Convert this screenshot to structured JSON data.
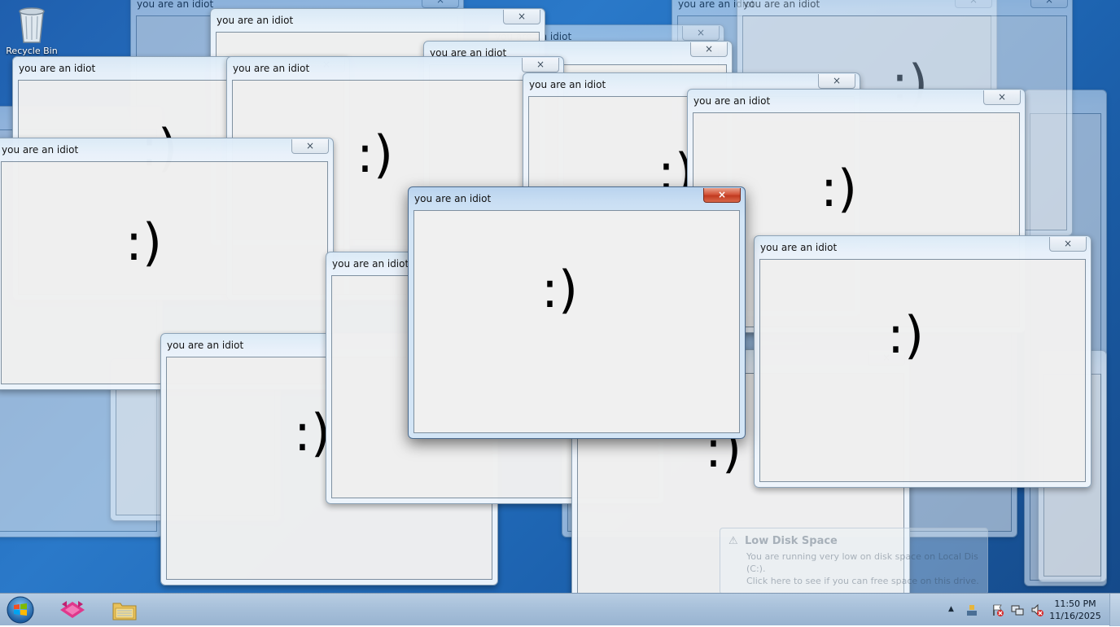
{
  "desktop": {
    "icons": [
      {
        "label": "Recycle Bin",
        "icon": "recycle-bin-icon"
      }
    ]
  },
  "popup": {
    "title": "you are an idiot",
    "content": ":)",
    "close_glyph": "×"
  },
  "notification": {
    "title": "Low Disk Space",
    "line1": "You are running very low on disk space on Local Dis",
    "line2": "(C:).",
    "line3": "Click here to see if you can free space on this drive."
  },
  "taskbar": {
    "pinned": [
      {
        "name": "start-orb",
        "icon": "windows-logo-icon"
      },
      {
        "name": "app-pink",
        "icon": "pink-app-icon"
      },
      {
        "name": "explorer",
        "icon": "folder-icon"
      }
    ],
    "tray": {
      "expand": "▲",
      "icons": [
        "network-icon",
        "action-center-flag-icon",
        "network-disconnected-icon",
        "volume-muted-icon"
      ]
    },
    "clock": {
      "time": "11:50 PM",
      "date": "11/16/2025"
    }
  },
  "colors": {
    "desktop_bg": "#1f5fae",
    "window_frame": "#dbeaf7",
    "active_close": "#c13a20",
    "client_bg": "#f0f0f0"
  }
}
